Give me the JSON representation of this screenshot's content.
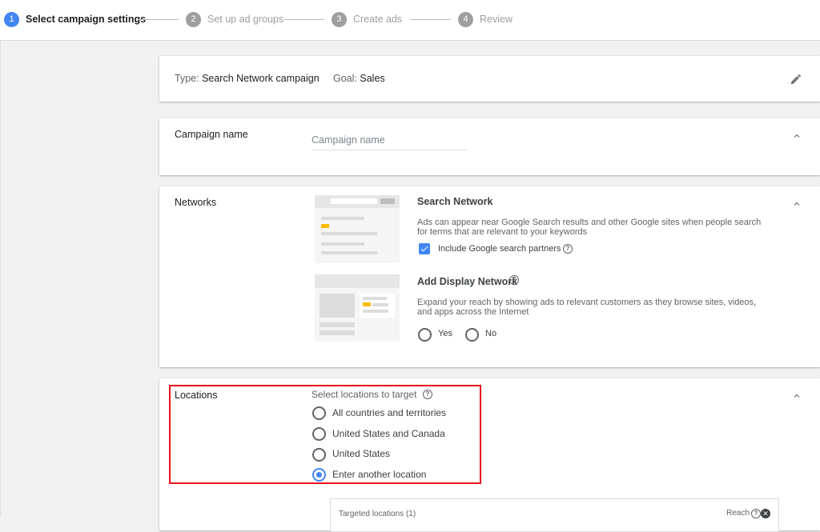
{
  "stepper": {
    "steps": [
      {
        "num": "1",
        "label": "Select campaign settings"
      },
      {
        "num": "2",
        "label": "Set up ad groups"
      },
      {
        "num": "3",
        "label": "Create ads"
      },
      {
        "num": "4",
        "label": "Review"
      }
    ]
  },
  "campaign_type": {
    "type_label": "Type:",
    "type_value": "Search Network campaign",
    "goal_label": "Goal:",
    "goal_value": "Sales"
  },
  "campaign_name": {
    "title": "Campaign name",
    "placeholder": "Campaign name"
  },
  "networks": {
    "title": "Networks",
    "search": {
      "title": "Search Network",
      "description": "Ads can appear near Google Search results and other Google sites when people search for terms that are relevant to your keywords",
      "partners_label": "Include Google search partners",
      "partners_checked": true
    },
    "display": {
      "title": "Add Display Network",
      "description": "Expand your reach by showing ads to relevant customers as they browse sites, videos, and apps across the Internet",
      "options": [
        "Yes",
        "No"
      ]
    }
  },
  "locations": {
    "title": "Locations",
    "prompt": "Select locations to target",
    "options": [
      {
        "label": "All countries and territories",
        "selected": false
      },
      {
        "label": "United States and Canada",
        "selected": false
      },
      {
        "label": "United States",
        "selected": false
      },
      {
        "label": "Enter another location",
        "selected": true
      }
    ],
    "targeted_title": "Targeted locations (1)",
    "reach_label": "Reach"
  },
  "colors": {
    "accent": "#4285f4",
    "highlight": "#e8131b",
    "yellow": "#fbbc04"
  }
}
